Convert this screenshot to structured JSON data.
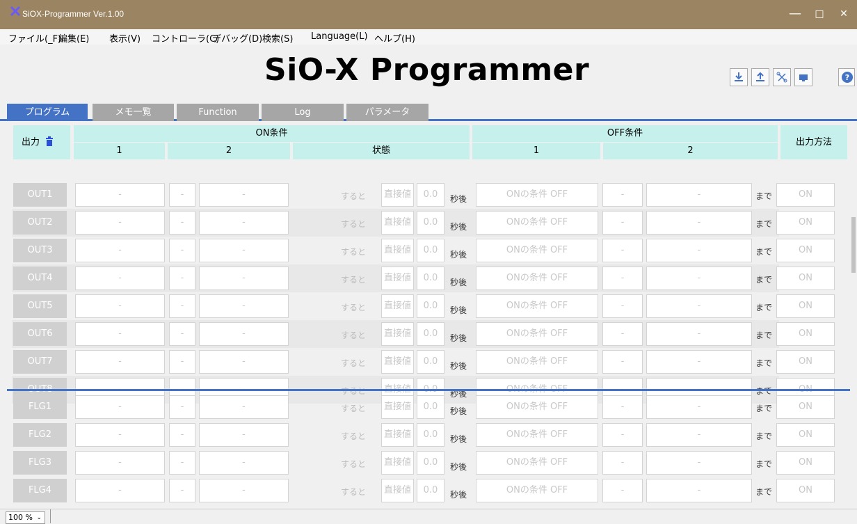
{
  "window": {
    "title": "SiOX-Programmer Ver.1.00",
    "minimize": "—",
    "maximize": "□",
    "close": "✕"
  },
  "menu": [
    "ファイル(_F)",
    "編集(E)",
    "表示(V)",
    "コントローラ(C)",
    "デバッグ(D)",
    "検索(S)",
    "Language(L)",
    "ヘルプ(H)"
  ],
  "app_title": "SiO-X Programmer",
  "toolbar_icons": [
    "download-icon",
    "upload-icon",
    "connect-icon",
    "monitor-icon",
    "help-icon"
  ],
  "tabs": [
    "プログラム",
    "メモ一覧",
    "Function",
    "Log",
    "パラメータ"
  ],
  "active_tab": 0,
  "header": {
    "output": "出力",
    "on_condition": "ON条件",
    "off_condition": "OFF条件",
    "output_method": "出力方法",
    "on_col1": "1",
    "on_col2": "2",
    "on_state": "状態",
    "off_col1": "1",
    "off_col2": "2"
  },
  "row_template": {
    "dash": "-",
    "suru_to": "すると",
    "direct_value": "直接値",
    "time_value": "0.0",
    "seconds_after": "秒後",
    "on_cond_off": "ONの条件 OFF",
    "made": "まで",
    "on": "ON"
  },
  "outputs": [
    "OUT1",
    "OUT2",
    "OUT3",
    "OUT4",
    "OUT5",
    "OUT6",
    "OUT7",
    "OUT8"
  ],
  "flags": [
    "FLG1",
    "FLG2",
    "FLG3",
    "FLG4"
  ],
  "zoom": "100 %",
  "colors": {
    "titlebar": "#9b8461",
    "accent": "#4472c4",
    "header_bg": "#c5f0ec",
    "inactive_tab": "#a6a6a6"
  }
}
